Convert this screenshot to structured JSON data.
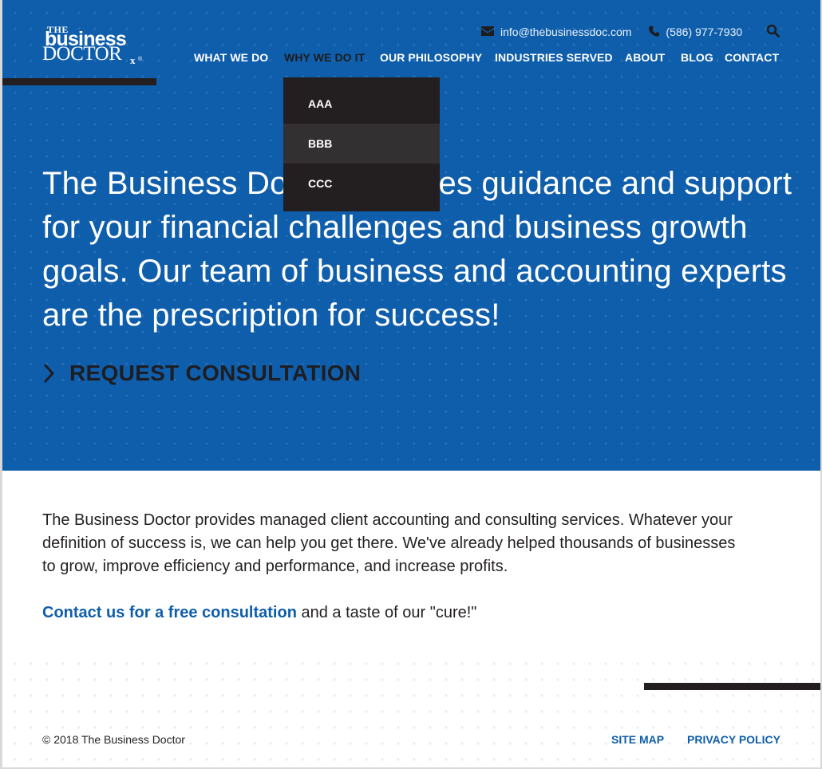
{
  "brand": {
    "logo_the": "THE",
    "logo_business": "business",
    "logo_doctor": "DOCTOR",
    "logo_rx": "x",
    "logo_reg": "®",
    "primary_color": "#0f5eab",
    "dark_color": "#231f20"
  },
  "header": {
    "email": "info@thebusinessdoc.com",
    "phone": "(586) 977-7930",
    "email_icon": "envelope-icon",
    "phone_icon": "phone-icon",
    "search_icon": "search-icon"
  },
  "nav": {
    "items": [
      {
        "label": "WHAT WE DO"
      },
      {
        "label": "WHY WE DO IT",
        "active": true
      },
      {
        "label": "OUR PHILOSOPHY"
      },
      {
        "label": "INDUSTRIES SERVED"
      },
      {
        "label": "ABOUT"
      },
      {
        "label": "BLOG"
      },
      {
        "label": "CONTACT"
      }
    ],
    "dropdown": {
      "items": [
        {
          "label": "AAA"
        },
        {
          "label": "BBB",
          "hovered": true
        },
        {
          "label": "CCC"
        }
      ]
    }
  },
  "hero": {
    "headline": "The Business Doctor provides guidance and support for your financial challenges and business growth goals. Our team of business and accounting experts are the prescription for success!",
    "cta_label": "REQUEST CONSULTATION",
    "cta_icon": "chevron-right-icon"
  },
  "intro": {
    "paragraph": "The Business Doctor provides managed client accounting and consulting services. Whatever your definition of success is, we can help you get there. We've already helped thousands of businesses to grow, improve efficiency and performance, and increase profits.",
    "contact_link": "Contact us for a free consultation",
    "contact_suffix": " and a taste of our \"cure!\""
  },
  "footer": {
    "copyright": "© 2018 The Business Doctor",
    "links": [
      {
        "label": "SITE MAP"
      },
      {
        "label": "PRIVACY POLICY"
      }
    ]
  }
}
